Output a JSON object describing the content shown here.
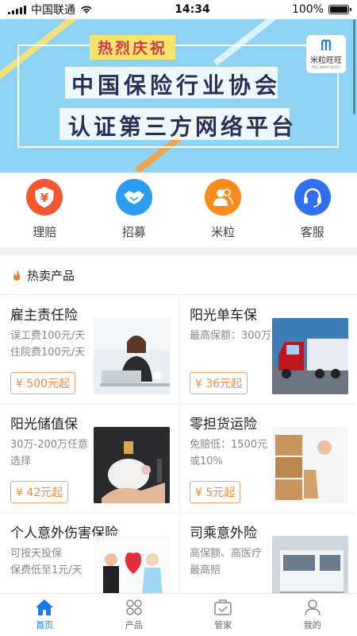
{
  "status_bar": {
    "carrier": "中国联通",
    "time": "14:34",
    "battery": "100%"
  },
  "banner": {
    "tag": "热烈庆祝",
    "line1": "中国保险行业协会",
    "line2": "认证第三方网络平台",
    "logo_text": "米粒旺旺",
    "logo_sub": "MILI WANG WANG"
  },
  "quick_actions": [
    {
      "label": "理赔",
      "icon": "yuan-shield-icon",
      "color": "#f4562e",
      "glyph": "¥"
    },
    {
      "label": "招募",
      "icon": "handshake-icon",
      "color": "#2c9cf0",
      "glyph": "🤝"
    },
    {
      "label": "米粒",
      "icon": "users-icon",
      "color": "#f98a1c",
      "glyph": "👥"
    },
    {
      "label": "客服",
      "icon": "headset-icon",
      "color": "#2f6ff0",
      "glyph": "☎"
    }
  ],
  "hot": {
    "title": "热卖产品",
    "products": [
      {
        "name": "雇主责任险",
        "desc1": "误工费100元/天",
        "desc2": "住院费100元/天",
        "price": "¥ 500元起",
        "image": "office-woman-laptop"
      },
      {
        "name": "阳光单车保",
        "desc1": "最高保额：300万",
        "desc2": "",
        "price": "¥ 36元起",
        "image": "red-truck"
      },
      {
        "name": "阳光储值保",
        "desc1": "30万-200万任意",
        "desc2": "选择",
        "price": "¥ 42元起",
        "image": "piggy-bank-coin"
      },
      {
        "name": "零担货运险",
        "desc1": "免赔低：1500元",
        "desc2": "或10%",
        "price": "¥ 5元起",
        "image": "man-with-boxes"
      },
      {
        "name": "个人意外伤害保险",
        "desc1": "可按天投保",
        "desc2": "保费低至1元/天",
        "price": "",
        "image": "couple-heart"
      },
      {
        "name": "司乘意外险",
        "desc1": "高保额、高医疗",
        "desc2": "最高赔",
        "price": "",
        "image": "white-truck"
      }
    ]
  },
  "tabs": [
    {
      "label": "首页",
      "icon": "home-icon",
      "active": true
    },
    {
      "label": "产品",
      "icon": "grid-icon",
      "active": false
    },
    {
      "label": "管家",
      "icon": "briefcase-icon",
      "active": false
    },
    {
      "label": "我的",
      "icon": "user-icon",
      "active": false
    }
  ],
  "colors": {
    "accent": "#1a78f2",
    "price": "#f08a3e",
    "banner_bg": "#8fd3f4"
  }
}
